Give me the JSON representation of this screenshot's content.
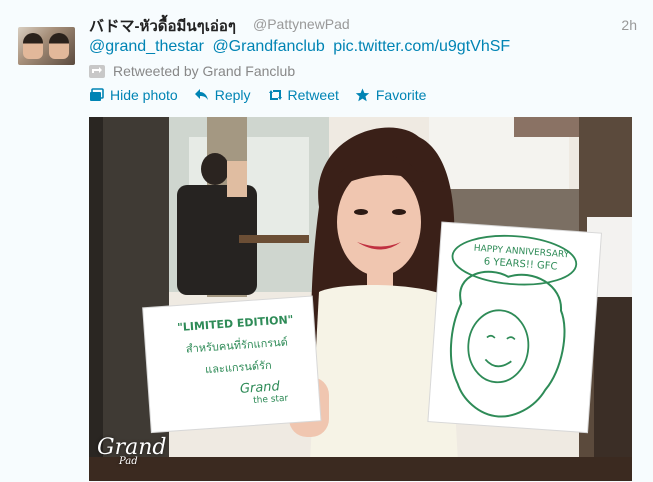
{
  "tweet": {
    "fullname": "バドマ-หัวดื้อมีนๆเอ่อๆ",
    "username": "@PattynewPad",
    "time": "2h",
    "mention_1": "@grand_thestar",
    "mention_2": "@Grandfanclub",
    "link": "pic.twitter.com/u9gtVhSF",
    "retweeted_by": "Retweeted by Grand Fanclub"
  },
  "actions": {
    "hide_photo": "Hide photo",
    "reply": "Reply",
    "retweet": "Retweet",
    "favorite": "Favorite"
  },
  "photo": {
    "left_sign_line1": "\"LIMITED EDITION\"",
    "left_sign_line2": "สำหรับคนที่รักแกรนด์",
    "left_sign_line3": "และแกรนด์รัก",
    "left_sign_signature": "Grand",
    "left_sign_signature_sub": "the star",
    "right_sign_line1": "HAPPY ANNIVERSARY",
    "right_sign_line2": "6 YEARS!! GFC",
    "watermark": "Grand",
    "watermark_sub": "Pad"
  },
  "colors": {
    "link": "#0084b4",
    "marker_green": "#2e8b57"
  }
}
